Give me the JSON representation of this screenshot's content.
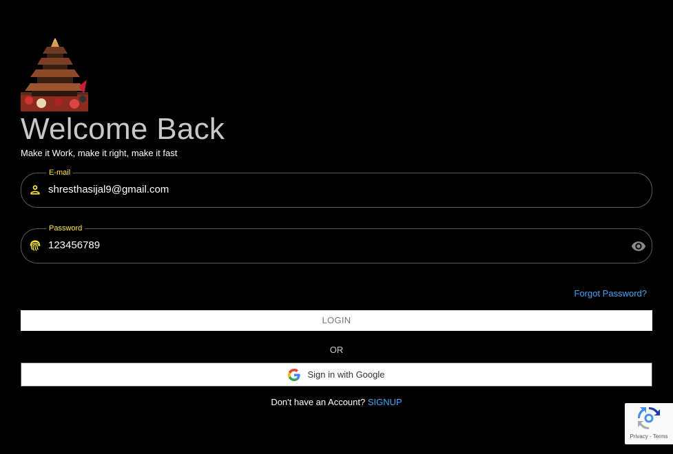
{
  "header": {
    "title": "Welcome Back",
    "subtitle": "Make it Work, make it right, make it fast"
  },
  "form": {
    "email": {
      "label": "E-mail",
      "value": "shresthasijal9@gmail.com"
    },
    "password": {
      "label": "Password",
      "value": "123456789"
    },
    "forgot_label": "Forgot Password?",
    "login_label": "LOGIN",
    "or_label": "OR",
    "google_label": "Sign in with Google"
  },
  "footer": {
    "prompt": "Don't have an Account? ",
    "signup_label": "SIGNUP"
  },
  "recaptcha": {
    "links": "Privacy - Terms"
  },
  "icons": {
    "email": "person-icon",
    "password": "fingerprint-icon",
    "visibility": "eye-icon",
    "google": "google-logo-icon",
    "recaptcha": "recaptcha-icon"
  },
  "colors": {
    "background": "#000000",
    "accent_label": "#ffeb3b",
    "link": "#42a5f5",
    "login_button_bg": "#ffffff"
  }
}
